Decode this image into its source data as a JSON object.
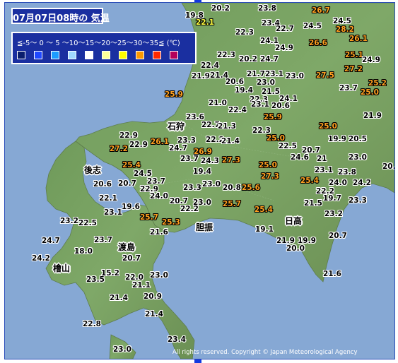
{
  "title": "07月07日08時の 気温",
  "legend": {
    "ranges_label": "≦-5〜 0 〜 5 〜10〜15〜20〜25〜30〜35≦ (℃)",
    "swatch_colors": [
      "#0a1e6e",
      "#1f48ff",
      "#1b9cff",
      "#a0d8ff",
      "#ffffff",
      "#ffff99",
      "#ffff00",
      "#ff9900",
      "#ff2800",
      "#b4005a"
    ]
  },
  "places": {
    "ishikari": "石狩",
    "shiribeshi": "後志",
    "iburi": "胆振",
    "hidaka": "日高",
    "oshima": "渡島",
    "hiyama": "檜山"
  },
  "temperatures": [
    {
      "v": "19.8",
      "c": "white"
    },
    {
      "v": "20.2",
      "c": "white"
    },
    {
      "v": "23.8",
      "c": "white"
    },
    {
      "v": "26.7",
      "c": "orange"
    },
    {
      "v": "22.1",
      "c": "yellow"
    },
    {
      "v": "22.3",
      "c": "white"
    },
    {
      "v": "23.4",
      "c": "white"
    },
    {
      "v": "22.7",
      "c": "white"
    },
    {
      "v": "24.5",
      "c": "white"
    },
    {
      "v": "24.5",
      "c": "white"
    },
    {
      "v": "28.2",
      "c": "orange"
    },
    {
      "v": "24.1",
      "c": "white"
    },
    {
      "v": "26.6",
      "c": "orange"
    },
    {
      "v": "26.1",
      "c": "orange"
    },
    {
      "v": "24.9",
      "c": "white"
    },
    {
      "v": "22.3",
      "c": "white"
    },
    {
      "v": "20.2",
      "c": "white"
    },
    {
      "v": "24.7",
      "c": "white"
    },
    {
      "v": "25.1",
      "c": "orange"
    },
    {
      "v": "24.9",
      "c": "white"
    },
    {
      "v": "22.4",
      "c": "white"
    },
    {
      "v": "27.2",
      "c": "orange"
    },
    {
      "v": "21.9",
      "c": "white"
    },
    {
      "v": "21.4",
      "c": "white"
    },
    {
      "v": "21.7",
      "c": "white"
    },
    {
      "v": "23.1",
      "c": "white"
    },
    {
      "v": "23.0",
      "c": "white"
    },
    {
      "v": "27.5",
      "c": "orange"
    },
    {
      "v": "20.6",
      "c": "white"
    },
    {
      "v": "23.0",
      "c": "white"
    },
    {
      "v": "25.2",
      "c": "orange"
    },
    {
      "v": "19.4",
      "c": "white"
    },
    {
      "v": "21.5",
      "c": "white"
    },
    {
      "v": "23.7",
      "c": "white"
    },
    {
      "v": "25.0",
      "c": "orange"
    },
    {
      "v": "25.9",
      "c": "orange"
    },
    {
      "v": "22.3",
      "c": "white"
    },
    {
      "v": "24.1",
      "c": "white"
    },
    {
      "v": "21.0",
      "c": "white"
    },
    {
      "v": "22.4",
      "c": "white"
    },
    {
      "v": "23.1",
      "c": "white"
    },
    {
      "v": "20.6",
      "c": "white"
    },
    {
      "v": "21.9",
      "c": "white"
    },
    {
      "v": "25.9",
      "c": "orange"
    },
    {
      "v": "23.6",
      "c": "white"
    },
    {
      "v": "22.7",
      "c": "white"
    },
    {
      "v": "21.3",
      "c": "white"
    },
    {
      "v": "25.0",
      "c": "orange"
    },
    {
      "v": "22.9",
      "c": "white"
    },
    {
      "v": "22.3",
      "c": "white"
    },
    {
      "v": "23.3",
      "c": "white"
    },
    {
      "v": "22.2",
      "c": "white"
    },
    {
      "v": "25.0",
      "c": "orange"
    },
    {
      "v": "19.9",
      "c": "white"
    },
    {
      "v": "20.5",
      "c": "white"
    },
    {
      "v": "27.2",
      "c": "orange"
    },
    {
      "v": "22.9",
      "c": "white"
    },
    {
      "v": "26.1",
      "c": "orange"
    },
    {
      "v": "24.7",
      "c": "white"
    },
    {
      "v": "21.4",
      "c": "white"
    },
    {
      "v": "22.5",
      "c": "white"
    },
    {
      "v": "26.9",
      "c": "orange"
    },
    {
      "v": "20.7",
      "c": "white"
    },
    {
      "v": "23.0",
      "c": "white"
    },
    {
      "v": "25.4",
      "c": "orange"
    },
    {
      "v": "23.7",
      "c": "white"
    },
    {
      "v": "24.3",
      "c": "white"
    },
    {
      "v": "27.3",
      "c": "orange"
    },
    {
      "v": "24.6",
      "c": "white"
    },
    {
      "v": "21",
      "c": "white"
    },
    {
      "v": "20.2",
      "c": "white"
    },
    {
      "v": "24.5",
      "c": "white"
    },
    {
      "v": "19.4",
      "c": "white"
    },
    {
      "v": "25.0",
      "c": "orange"
    },
    {
      "v": "23.1",
      "c": "white"
    },
    {
      "v": "23.8",
      "c": "white"
    },
    {
      "v": "20.6",
      "c": "white"
    },
    {
      "v": "20.7",
      "c": "white"
    },
    {
      "v": "23.7",
      "c": "white"
    },
    {
      "v": "27.3",
      "c": "orange"
    },
    {
      "v": "25.4",
      "c": "orange"
    },
    {
      "v": "24.0",
      "c": "white"
    },
    {
      "v": "24.2",
      "c": "white"
    },
    {
      "v": "22.9",
      "c": "white"
    },
    {
      "v": "23.3",
      "c": "white"
    },
    {
      "v": "23.0",
      "c": "white"
    },
    {
      "v": "20.8",
      "c": "white"
    },
    {
      "v": "25.6",
      "c": "orange"
    },
    {
      "v": "22.2",
      "c": "white"
    },
    {
      "v": "22.1",
      "c": "white"
    },
    {
      "v": "24.0",
      "c": "white"
    },
    {
      "v": "20.7",
      "c": "white"
    },
    {
      "v": "23.0",
      "c": "white"
    },
    {
      "v": "25.7",
      "c": "orange"
    },
    {
      "v": "19.7",
      "c": "white"
    },
    {
      "v": "23.3",
      "c": "white"
    },
    {
      "v": "19.6",
      "c": "white"
    },
    {
      "v": "22.2",
      "c": "white"
    },
    {
      "v": "25.4",
      "c": "orange"
    },
    {
      "v": "21.5",
      "c": "white"
    },
    {
      "v": "23.1",
      "c": "white"
    },
    {
      "v": "25.7",
      "c": "orange"
    },
    {
      "v": "25.3",
      "c": "orange"
    },
    {
      "v": "23.2",
      "c": "white"
    },
    {
      "v": "23.2",
      "c": "white"
    },
    {
      "v": "22.5",
      "c": "white"
    },
    {
      "v": "21.6",
      "c": "white"
    },
    {
      "v": "19.1",
      "c": "white"
    },
    {
      "v": "20.7",
      "c": "white"
    },
    {
      "v": "24.7",
      "c": "white"
    },
    {
      "v": "23.7",
      "c": "white"
    },
    {
      "v": "21.9",
      "c": "white"
    },
    {
      "v": "19.9",
      "c": "white"
    },
    {
      "v": "18.0",
      "c": "white"
    },
    {
      "v": "20.0",
      "c": "white"
    },
    {
      "v": "24.2",
      "c": "white"
    },
    {
      "v": "20.7",
      "c": "white"
    },
    {
      "v": "15.2",
      "c": "white"
    },
    {
      "v": "21.6",
      "c": "white"
    },
    {
      "v": "23.5",
      "c": "white"
    },
    {
      "v": "22.0",
      "c": "white"
    },
    {
      "v": "23.0",
      "c": "white"
    },
    {
      "v": "21.1",
      "c": "white"
    },
    {
      "v": "21.4",
      "c": "white"
    },
    {
      "v": "20.9",
      "c": "white"
    },
    {
      "v": "21.4",
      "c": "white"
    },
    {
      "v": "22.8",
      "c": "white"
    },
    {
      "v": "23.4",
      "c": "white"
    },
    {
      "v": "23.0",
      "c": "white"
    }
  ],
  "copyright": "All rights reserved. Copyright © Japan Meteorological Agency"
}
